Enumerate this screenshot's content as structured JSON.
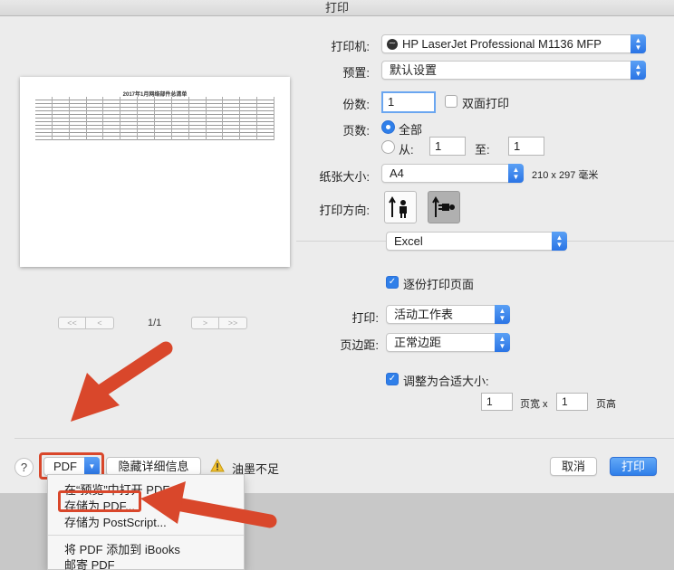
{
  "window": {
    "title": "打印"
  },
  "preview": {
    "sheet_title": "2017年1月网络部件总清单",
    "page_indicator": "1/1",
    "nav": {
      "first": "<<",
      "prev": "<",
      "next": ">",
      "last": ">>"
    }
  },
  "printer": {
    "label": "打印机:",
    "value": "HP LaserJet Professional M1136 MFP"
  },
  "preset": {
    "label": "预置:",
    "value": "默认设置"
  },
  "copies": {
    "label": "份数:",
    "value": "1",
    "duplex_label": "双面打印",
    "duplex_checked": false
  },
  "pages": {
    "label": "页数:",
    "all_label": "全部",
    "from_label": "从:",
    "from_value": "1",
    "to_label": "至:",
    "to_value": "1",
    "selected": "all"
  },
  "paper": {
    "label": "纸张大小:",
    "value": "A4",
    "dimensions": "210 x 297 毫米"
  },
  "orientation": {
    "label": "打印方向:",
    "selected": "landscape"
  },
  "app_section": {
    "value": "Excel"
  },
  "collate": {
    "label": "逐份打印页面",
    "checked": true
  },
  "print_what": {
    "label": "打印:",
    "value": "活动工作表"
  },
  "margins": {
    "label": "页边距:",
    "value": "正常边距"
  },
  "scale": {
    "label": "调整为合适大小:",
    "checked": true,
    "width_value": "1",
    "width_label": "页宽 x",
    "height_value": "1",
    "height_label": "页高"
  },
  "bottom": {
    "help": "?",
    "pdf_button": "PDF",
    "hide_details": "隐藏详细信息",
    "warning": "油墨不足",
    "cancel": "取消",
    "print": "打印"
  },
  "pdf_menu": {
    "items": [
      "在“预览”中打开 PDF",
      "存储为 PDF...",
      "存储为 PostScript...",
      "将 PDF 添加到 iBooks",
      "邮寄 PDF"
    ]
  },
  "colors": {
    "accent": "#2f7fe9",
    "annotation": "#d9472b",
    "window_bg": "#ececec"
  }
}
